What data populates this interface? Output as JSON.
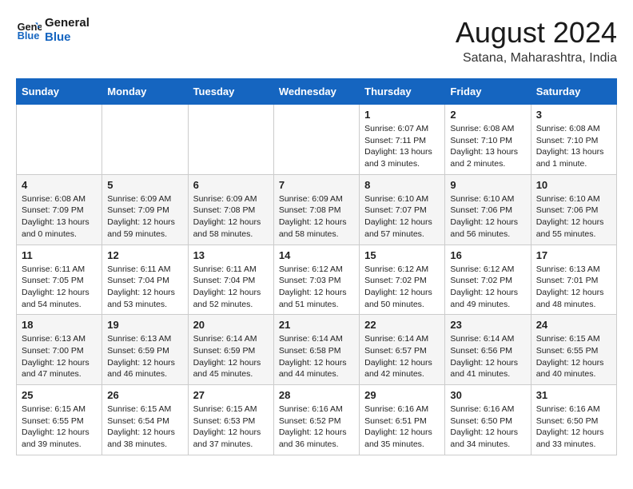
{
  "header": {
    "logo_line1": "General",
    "logo_line2": "Blue",
    "month_year": "August 2024",
    "location": "Satana, Maharashtra, India"
  },
  "days_of_week": [
    "Sunday",
    "Monday",
    "Tuesday",
    "Wednesday",
    "Thursday",
    "Friday",
    "Saturday"
  ],
  "weeks": [
    [
      {
        "day": "",
        "info": ""
      },
      {
        "day": "",
        "info": ""
      },
      {
        "day": "",
        "info": ""
      },
      {
        "day": "",
        "info": ""
      },
      {
        "day": "1",
        "info": "Sunrise: 6:07 AM\nSunset: 7:11 PM\nDaylight: 13 hours\nand 3 minutes."
      },
      {
        "day": "2",
        "info": "Sunrise: 6:08 AM\nSunset: 7:10 PM\nDaylight: 13 hours\nand 2 minutes."
      },
      {
        "day": "3",
        "info": "Sunrise: 6:08 AM\nSunset: 7:10 PM\nDaylight: 13 hours\nand 1 minute."
      }
    ],
    [
      {
        "day": "4",
        "info": "Sunrise: 6:08 AM\nSunset: 7:09 PM\nDaylight: 13 hours\nand 0 minutes."
      },
      {
        "day": "5",
        "info": "Sunrise: 6:09 AM\nSunset: 7:09 PM\nDaylight: 12 hours\nand 59 minutes."
      },
      {
        "day": "6",
        "info": "Sunrise: 6:09 AM\nSunset: 7:08 PM\nDaylight: 12 hours\nand 58 minutes."
      },
      {
        "day": "7",
        "info": "Sunrise: 6:09 AM\nSunset: 7:08 PM\nDaylight: 12 hours\nand 58 minutes."
      },
      {
        "day": "8",
        "info": "Sunrise: 6:10 AM\nSunset: 7:07 PM\nDaylight: 12 hours\nand 57 minutes."
      },
      {
        "day": "9",
        "info": "Sunrise: 6:10 AM\nSunset: 7:06 PM\nDaylight: 12 hours\nand 56 minutes."
      },
      {
        "day": "10",
        "info": "Sunrise: 6:10 AM\nSunset: 7:06 PM\nDaylight: 12 hours\nand 55 minutes."
      }
    ],
    [
      {
        "day": "11",
        "info": "Sunrise: 6:11 AM\nSunset: 7:05 PM\nDaylight: 12 hours\nand 54 minutes."
      },
      {
        "day": "12",
        "info": "Sunrise: 6:11 AM\nSunset: 7:04 PM\nDaylight: 12 hours\nand 53 minutes."
      },
      {
        "day": "13",
        "info": "Sunrise: 6:11 AM\nSunset: 7:04 PM\nDaylight: 12 hours\nand 52 minutes."
      },
      {
        "day": "14",
        "info": "Sunrise: 6:12 AM\nSunset: 7:03 PM\nDaylight: 12 hours\nand 51 minutes."
      },
      {
        "day": "15",
        "info": "Sunrise: 6:12 AM\nSunset: 7:02 PM\nDaylight: 12 hours\nand 50 minutes."
      },
      {
        "day": "16",
        "info": "Sunrise: 6:12 AM\nSunset: 7:02 PM\nDaylight: 12 hours\nand 49 minutes."
      },
      {
        "day": "17",
        "info": "Sunrise: 6:13 AM\nSunset: 7:01 PM\nDaylight: 12 hours\nand 48 minutes."
      }
    ],
    [
      {
        "day": "18",
        "info": "Sunrise: 6:13 AM\nSunset: 7:00 PM\nDaylight: 12 hours\nand 47 minutes."
      },
      {
        "day": "19",
        "info": "Sunrise: 6:13 AM\nSunset: 6:59 PM\nDaylight: 12 hours\nand 46 minutes."
      },
      {
        "day": "20",
        "info": "Sunrise: 6:14 AM\nSunset: 6:59 PM\nDaylight: 12 hours\nand 45 minutes."
      },
      {
        "day": "21",
        "info": "Sunrise: 6:14 AM\nSunset: 6:58 PM\nDaylight: 12 hours\nand 44 minutes."
      },
      {
        "day": "22",
        "info": "Sunrise: 6:14 AM\nSunset: 6:57 PM\nDaylight: 12 hours\nand 42 minutes."
      },
      {
        "day": "23",
        "info": "Sunrise: 6:14 AM\nSunset: 6:56 PM\nDaylight: 12 hours\nand 41 minutes."
      },
      {
        "day": "24",
        "info": "Sunrise: 6:15 AM\nSunset: 6:55 PM\nDaylight: 12 hours\nand 40 minutes."
      }
    ],
    [
      {
        "day": "25",
        "info": "Sunrise: 6:15 AM\nSunset: 6:55 PM\nDaylight: 12 hours\nand 39 minutes."
      },
      {
        "day": "26",
        "info": "Sunrise: 6:15 AM\nSunset: 6:54 PM\nDaylight: 12 hours\nand 38 minutes."
      },
      {
        "day": "27",
        "info": "Sunrise: 6:15 AM\nSunset: 6:53 PM\nDaylight: 12 hours\nand 37 minutes."
      },
      {
        "day": "28",
        "info": "Sunrise: 6:16 AM\nSunset: 6:52 PM\nDaylight: 12 hours\nand 36 minutes."
      },
      {
        "day": "29",
        "info": "Sunrise: 6:16 AM\nSunset: 6:51 PM\nDaylight: 12 hours\nand 35 minutes."
      },
      {
        "day": "30",
        "info": "Sunrise: 6:16 AM\nSunset: 6:50 PM\nDaylight: 12 hours\nand 34 minutes."
      },
      {
        "day": "31",
        "info": "Sunrise: 6:16 AM\nSunset: 6:50 PM\nDaylight: 12 hours\nand 33 minutes."
      }
    ]
  ]
}
